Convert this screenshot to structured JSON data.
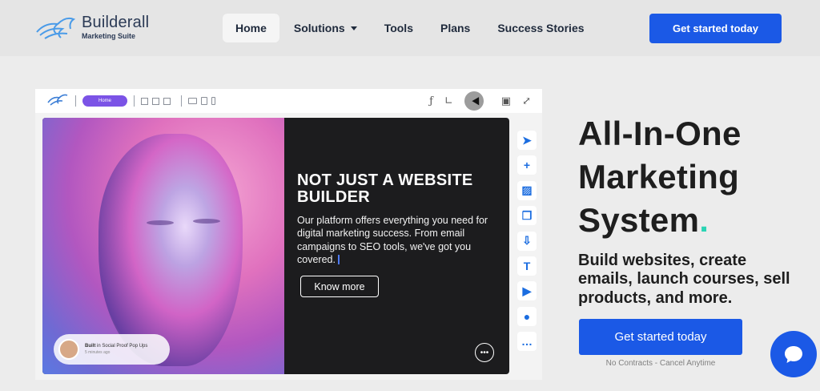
{
  "nav": {
    "brand_name": "Builderall",
    "brand_sub": "Marketing Suite",
    "items": [
      {
        "label": "Home",
        "active": true
      },
      {
        "label": "Solutions",
        "has_dropdown": true
      },
      {
        "label": "Tools"
      },
      {
        "label": "Plans"
      },
      {
        "label": "Success Stories"
      }
    ],
    "cta_label": "Get started today"
  },
  "editor": {
    "page_pill": "Home",
    "toolbar_icons": [
      "layout-icon",
      "layout-icon",
      "layout-icon",
      "desktop-icon",
      "tablet-icon",
      "mobile-icon",
      "font-icon",
      "ruler-icon",
      "cursor-icon",
      "save-icon",
      "fullscreen-icon"
    ],
    "canvas": {
      "title": "NOT JUST A WEBSITE BUILDER",
      "description": "Our platform offers everything you need for digital marketing success. From email campaigns to SEO tools, we've got you covered.",
      "button_label": "Know more",
      "social_proof_built": "Built",
      "social_proof_rest": "in Social Proof Pop Ups",
      "social_proof_time": "5 minutes ago"
    },
    "side_tools": [
      "pointer-icon",
      "add-icon",
      "image-icon",
      "copy-icon",
      "download-icon",
      "text-icon",
      "play-icon",
      "user-icon",
      "chat-icon"
    ]
  },
  "hero": {
    "headline": "All-In-One Marketing System",
    "headline_dot": ".",
    "subline": "Build websites, create emails, launch courses, sell products, and more.",
    "cta_label": "Get started today",
    "note": "No Contracts - Cancel Anytime"
  },
  "colors": {
    "primary": "#1b59e6",
    "accent_dot": "#2bd4b4",
    "pill": "#7b53e6"
  }
}
